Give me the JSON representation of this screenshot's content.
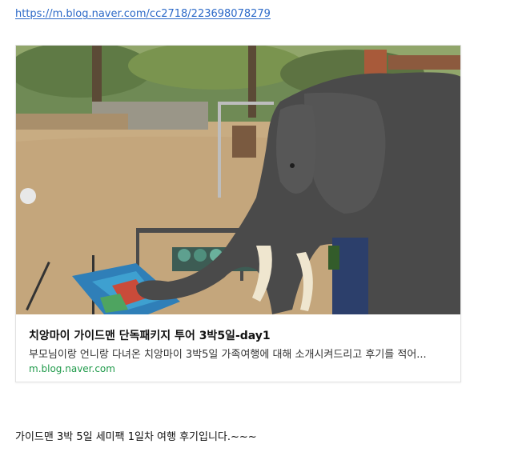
{
  "link": {
    "url": "https://m.blog.naver.com/cc2718/223698078279"
  },
  "preview_card": {
    "image_alt": "elephant-painting-photo",
    "title": "치앙마이 가이드맨 단독패키지 투어 3박5일-day1",
    "description": "부모님이랑 언니랑 다녀온 치앙마이 3박5일 가족여행에 대해 소개시켜드리고 후기를 적어...",
    "domain": "m.blog.naver.com",
    "colors": {
      "domain": "#1f9a4a",
      "link": "#2d6ac8"
    }
  },
  "post": {
    "text": "가이드맨 3박 5일 세미팩 1일차 여행 후기입니다.~~~"
  }
}
